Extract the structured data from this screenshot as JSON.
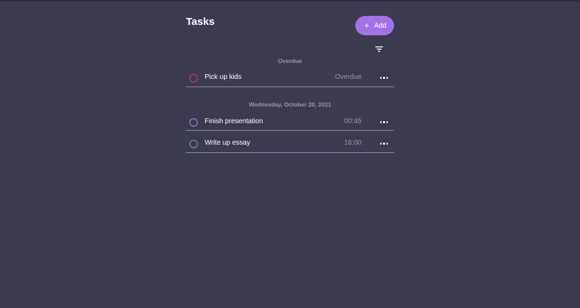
{
  "header": {
    "title": "Tasks",
    "add_label": "Add",
    "accent_color": "#a173e6"
  },
  "groups": [
    {
      "label": "Overdue",
      "tasks": [
        {
          "name": "Pick up kids",
          "time": "Overdue",
          "circle_color": "#e0454f"
        }
      ]
    },
    {
      "label": "Wednesday, October 20, 2021",
      "tasks": [
        {
          "name": "Finish presentation",
          "time": "00:45",
          "circle_color": "#b98af0"
        },
        {
          "name": "Write up essay",
          "time": "16:00",
          "circle_color": "#5fb87a"
        }
      ]
    }
  ],
  "icons": {
    "add": "plus-icon",
    "filter": "filter-icon",
    "more": "more-horizontal-icon"
  }
}
